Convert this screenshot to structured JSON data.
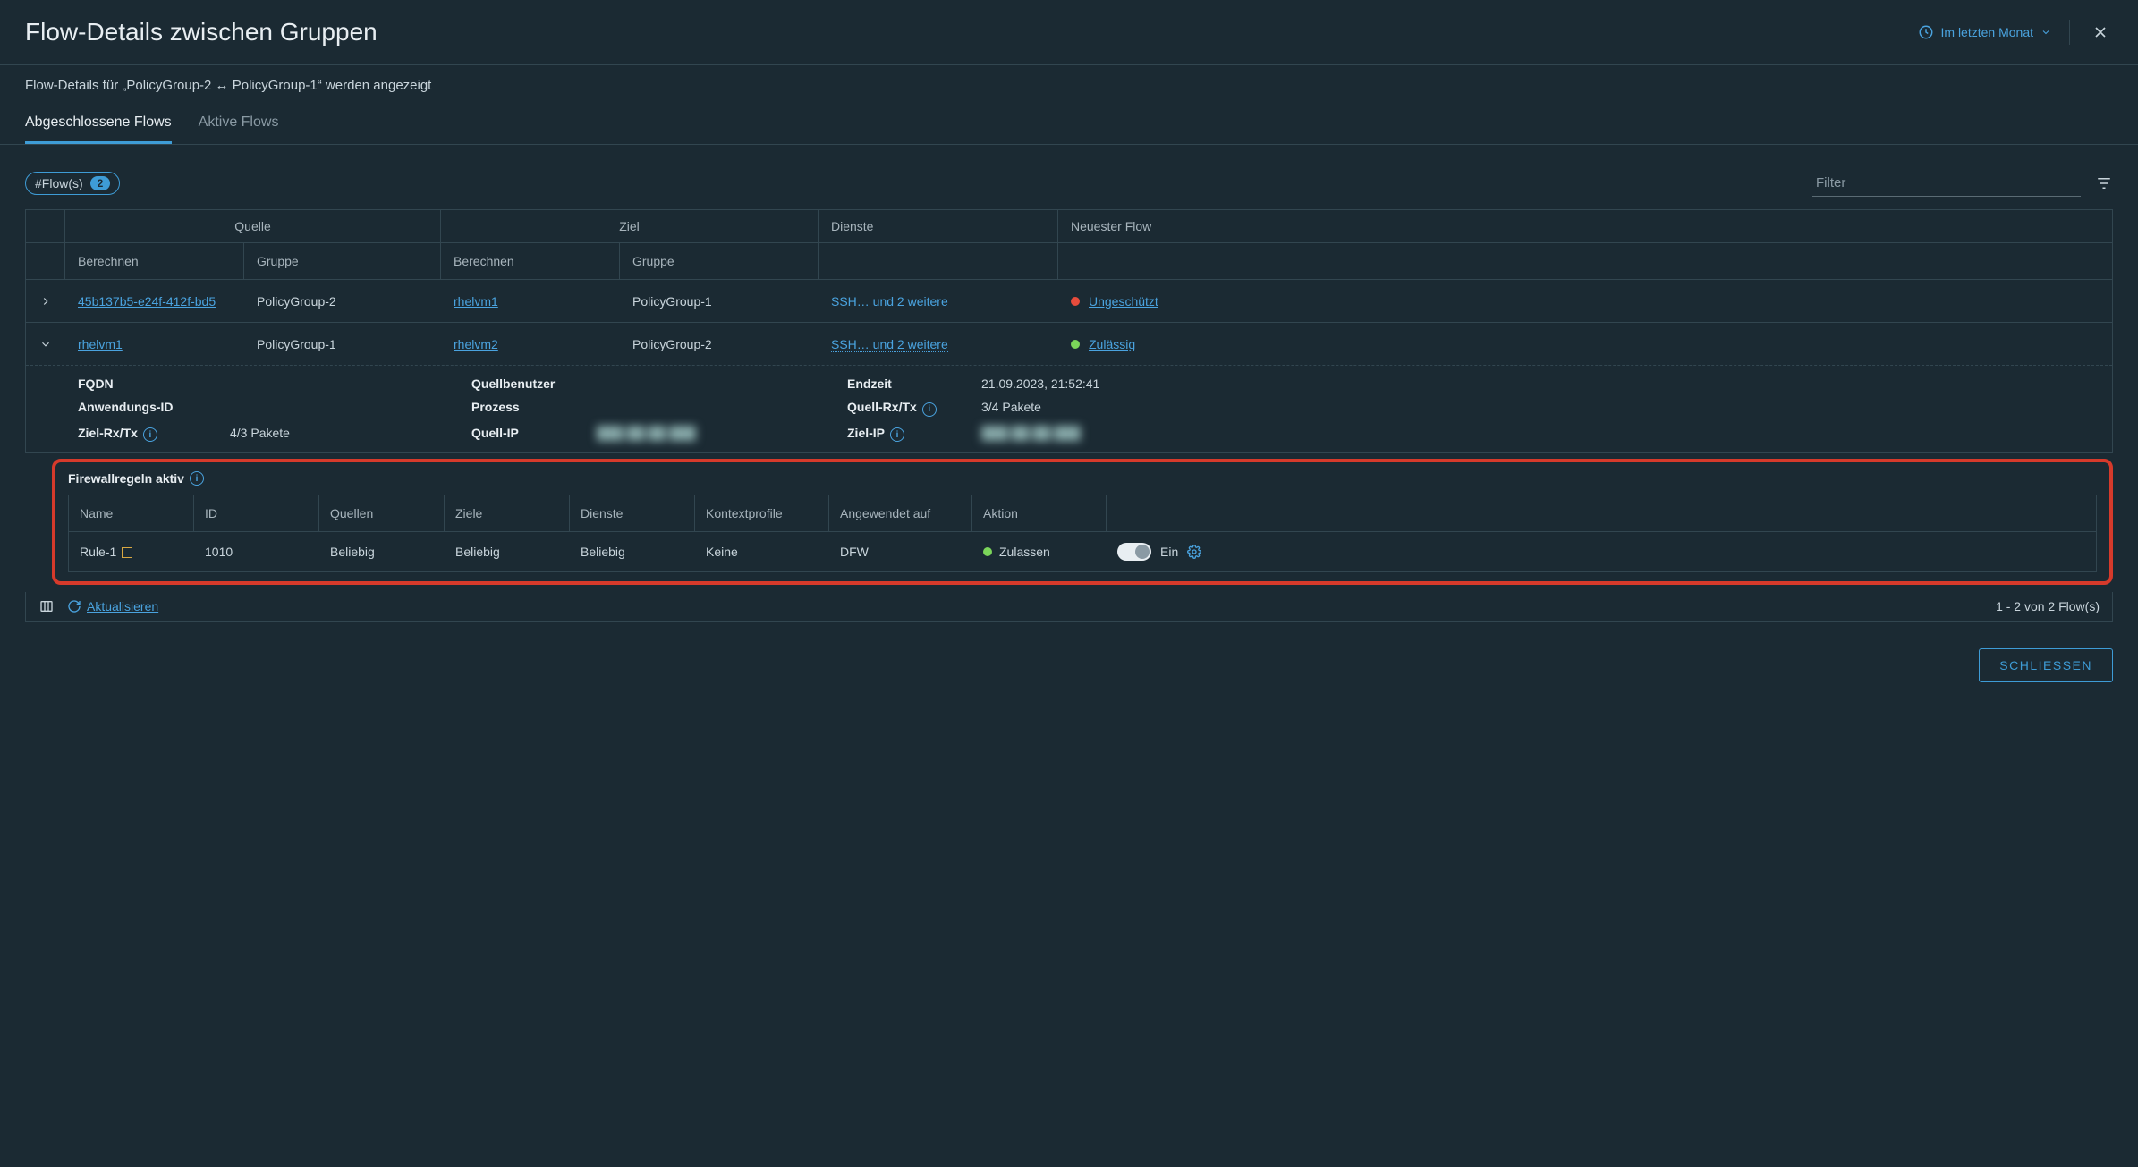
{
  "header": {
    "title": "Flow-Details zwischen Gruppen",
    "time_label": "Im letzten Monat"
  },
  "subheader": "Flow-Details für „PolicyGroup-2 ↔ PolicyGroup-1“ werden angezeigt",
  "tabs": {
    "completed": "Abgeschlossene Flows",
    "active": "Aktive Flows"
  },
  "toolbar": {
    "flow_label": "#Flow(s)",
    "flow_count": "2",
    "filter_placeholder": "Filter"
  },
  "columns": {
    "source": "Quelle",
    "dest": "Ziel",
    "compute": "Berechnen",
    "group": "Gruppe",
    "services": "Dienste",
    "newest": "Neuester Flow"
  },
  "rows": [
    {
      "src_compute": "45b137b5-e24f-412f-bd5",
      "src_group": "PolicyGroup-2",
      "dst_compute": "rhelvm1",
      "dst_group": "PolicyGroup-1",
      "services": "SSH… und 2 weitere",
      "status_color": "red",
      "status": "Ungeschützt"
    },
    {
      "src_compute": "rhelvm1",
      "src_group": "PolicyGroup-1",
      "dst_compute": "rhelvm2",
      "dst_group": "PolicyGroup-2",
      "services": "SSH… und 2 weitere",
      "status_color": "green",
      "status": "Zulässig"
    }
  ],
  "detail": {
    "labels": {
      "fqdn": "FQDN",
      "app_id": "Anwendungs-ID",
      "dst_rxtx": "Ziel-Rx/Tx",
      "src_user": "Quellbenutzer",
      "process": "Prozess",
      "src_ip": "Quell-IP",
      "end_time": "Endzeit",
      "src_rxtx": "Quell-Rx/Tx",
      "dst_ip": "Ziel-IP"
    },
    "values": {
      "dst_rxtx": "4/3 Pakete",
      "end_time": "21.09.2023, 21:52:41",
      "src_rxtx": "3/4 Pakete",
      "src_ip_masked": "███.██.██.███",
      "dst_ip_masked": "███.██.██.███"
    }
  },
  "firewall": {
    "title": "Firewallregeln aktiv",
    "headers": {
      "name": "Name",
      "id": "ID",
      "sources": "Quellen",
      "dests": "Ziele",
      "services": "Dienste",
      "profiles": "Kontextprofile",
      "applied": "Angewendet auf",
      "action": "Aktion"
    },
    "row": {
      "name": "Rule-1",
      "id": "1010",
      "sources": "Beliebig",
      "dests": "Beliebig",
      "services": "Beliebig",
      "profiles": "Keine",
      "applied": "DFW",
      "action": "Zulassen",
      "toggle_label": "Ein"
    }
  },
  "footer": {
    "refresh": "Aktualisieren",
    "pager": "1 - 2 von 2 Flow(s)",
    "close_button": "SCHLIESSEN"
  }
}
